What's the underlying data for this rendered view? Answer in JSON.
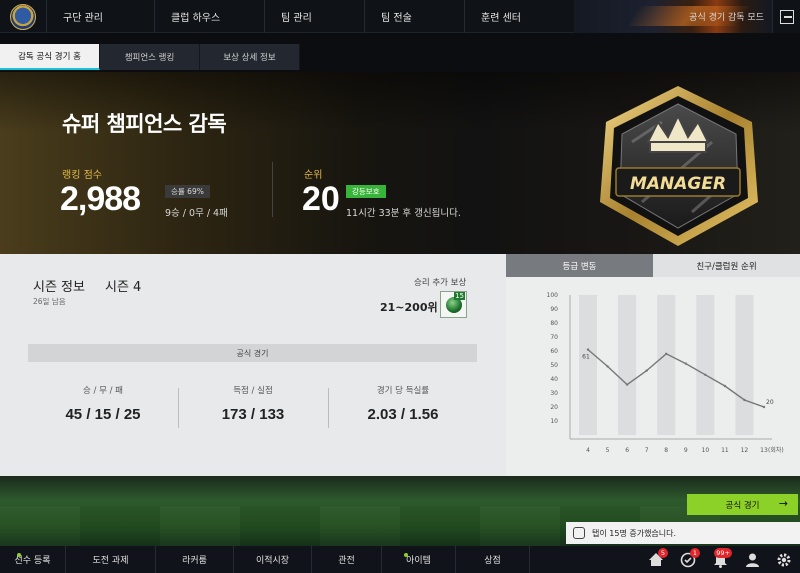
{
  "topnav": {
    "items": [
      "구단 관리",
      "클럽 하우스",
      "팀 관리",
      "팀 전술",
      "훈련 센터"
    ],
    "promo_text": "공식 경기 감독 모드"
  },
  "subtabs": [
    "감독 공식 경기 홈",
    "챔피언스 랭킹",
    "보상 상세 정보"
  ],
  "hero": {
    "title": "슈퍼 챔피언스 감독",
    "score_label": "랭킹 점수",
    "score_value": "2,988",
    "winrate": "승률 69%",
    "record": "9승 / 0무 / 4패",
    "rank_label": "순위",
    "rank_value": "20",
    "protect_badge": "강등보호",
    "update_text": "11시간 33분 후 갱신됩니다.",
    "emblem_text": "MANAGER"
  },
  "season": {
    "title": "시즌 정보",
    "season_no": "시즌 4",
    "remaining": "26일 남음",
    "reward_label": "승리 추가 보상",
    "reward_range": "21~200위",
    "reward_count": "15",
    "match_label": "공식 경기",
    "stats": [
      {
        "label": "승 / 무 / 패",
        "value": "45 / 15 / 25"
      },
      {
        "label": "득점 / 실점",
        "value": "173 / 133"
      },
      {
        "label": "경기 당 득실률",
        "value": "2.03 / 1.56"
      }
    ]
  },
  "graph": {
    "tabs": [
      "등급 변동",
      "친구/클럽원 순위"
    ],
    "unit_label": "(회차)"
  },
  "chart_data": {
    "type": "line",
    "x": [
      4,
      5,
      6,
      7,
      8,
      9,
      10,
      11,
      12,
      13
    ],
    "y": [
      61,
      49,
      36,
      46,
      58,
      51,
      43,
      35,
      25,
      20
    ],
    "ylim": [
      100,
      0
    ],
    "yticks": [
      10,
      20,
      30,
      40,
      50,
      60,
      70,
      80,
      90,
      100
    ],
    "xticks": [
      4,
      5,
      6,
      7,
      8,
      9,
      10,
      11,
      12,
      13
    ],
    "data_labels": [
      {
        "x": 4,
        "text": "61"
      },
      {
        "x": 13,
        "text": "20"
      }
    ],
    "grid": "alternating-column-bands"
  },
  "actions": {
    "official_match_button": "공식 경기",
    "notice_text": "탭이 15명 증가했습니다."
  },
  "bottomnav": {
    "items": [
      "선수 등록",
      "도전 과제",
      "라커룸",
      "이적시장",
      "관전",
      "아이템",
      "상점"
    ],
    "badges": [
      "5",
      "1",
      "99+"
    ]
  },
  "colors": {
    "accent_green": "#8cd127",
    "gold": "#e2b94a",
    "protect_green": "#38b43a",
    "tab_cyan": "#19c3d6"
  }
}
